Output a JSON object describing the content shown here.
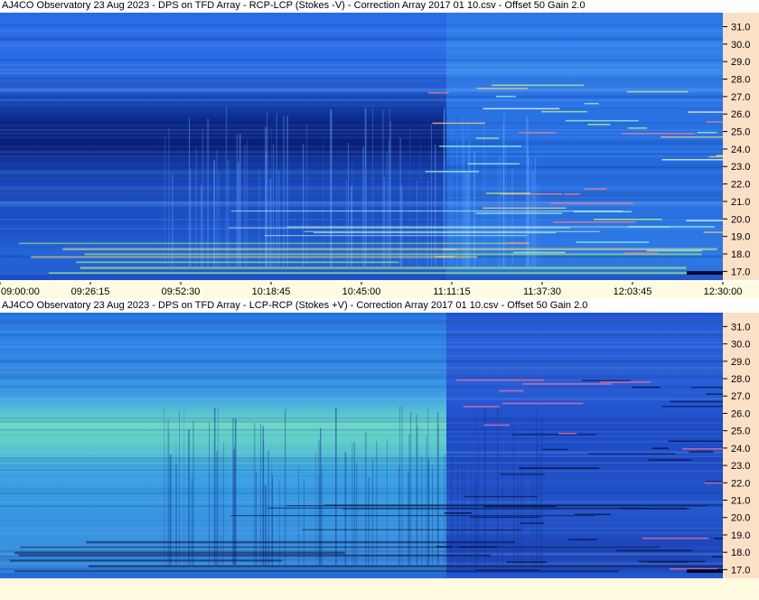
{
  "chart_data": [
    {
      "type": "heatmap",
      "title": "AJ4CO Observatory 23 Aug 2023 -  DPS on TFD Array  -  RCP-LCP (Stokes -V)  -  Correction Array 2017 01 10.csv  -  Offset 50  Gain 2.0",
      "y_ticks": [
        "17.0",
        "18.0",
        "19.0",
        "20.0",
        "21.0",
        "22.0",
        "23.0",
        "24.0",
        "25.0",
        "26.0",
        "27.0",
        "28.0",
        "29.0",
        "30.0",
        "31.0"
      ],
      "x_ticks": [
        "09:00:00",
        "09:26:15",
        "09:52:30",
        "10:18:45",
        "10:45:00",
        "11:11:15",
        "11:37:30",
        "12:03:45",
        "12:30:00"
      ],
      "ylim": [
        16.5,
        31.8
      ]
    },
    {
      "type": "heatmap",
      "title": "AJ4CO Observatory 23 Aug 2023 -  DPS on TFD Array  -  LCP-RCP (Stokes +V)  -  Correction Array 2017 01 10.csv  -  Offset 50  Gain 2.0",
      "y_ticks": [
        "17.0",
        "18.0",
        "19.0",
        "20.0",
        "21.0",
        "22.0",
        "23.0",
        "24.0",
        "25.0",
        "26.0",
        "27.0",
        "28.0",
        "29.0",
        "30.0",
        "31.0"
      ],
      "ylim": [
        16.5,
        31.8
      ]
    }
  ],
  "colors": {
    "axis_bg": "#fbe0c8",
    "xaxis_bg": "#fffbe0",
    "panel1_base": "#1a5ad8",
    "panel1_dark": "#0a1e7a",
    "panel2_base": "#2a7ae0",
    "panel2_bright": "#7ae0d0"
  }
}
